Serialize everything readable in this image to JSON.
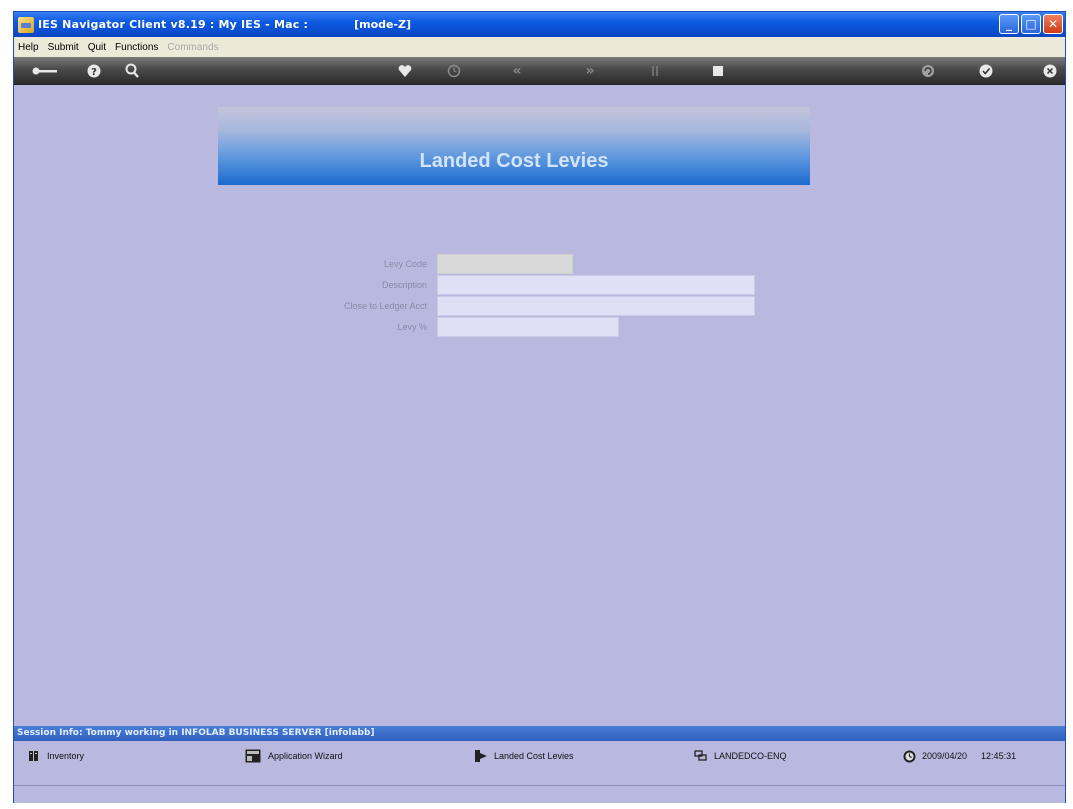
{
  "window": {
    "title": "IES Navigator Client v8.19 : My IES - Mac :",
    "mode": "[mode-Z]"
  },
  "menu": [
    "Help",
    "Submit",
    "Quit",
    "Functions",
    "Commands"
  ],
  "page": {
    "title": "Landed Cost Levies"
  },
  "form": {
    "levy_code_label": "Levy Code",
    "description_label": "Description",
    "ledger_label": "Close to Ledger Acct",
    "levy_pct_label": "Levy %",
    "levy_code_value": "",
    "description_value": "",
    "ledger_value": "",
    "levy_pct_value": ""
  },
  "session": {
    "text": "Session Info: Tommy working in INFOLAB BUSINESS SERVER  [infolabb]"
  },
  "taskbar": {
    "inventory": "Inventory",
    "wizard": "Application Wizard",
    "levies": "Landed Cost Levies",
    "screen_code": "LANDEDCO-ENQ",
    "date": "2009/04/20",
    "time": "12:45:31"
  }
}
